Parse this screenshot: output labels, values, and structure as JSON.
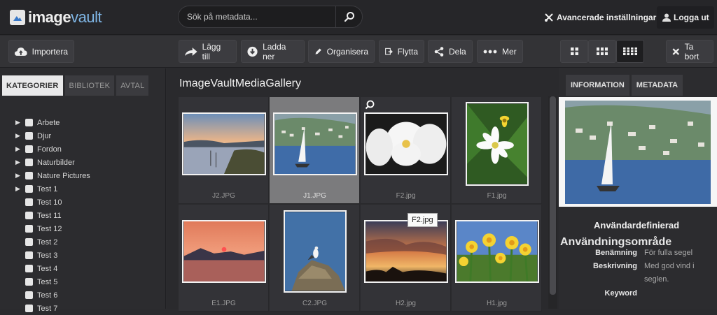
{
  "app": {
    "logo_prefix": "image",
    "logo_suffix": "vault"
  },
  "search": {
    "placeholder": "Sök på metadata..."
  },
  "header": {
    "advanced_settings": "Avancerade inställningar",
    "logout": "Logga ut"
  },
  "toolbar": {
    "import": "Importera",
    "add": "Lägg till",
    "download": "Ladda ner",
    "organize": "Organisera",
    "move": "Flytta",
    "share": "Dela",
    "more": "Mer",
    "remove": "Ta bort"
  },
  "left_tabs": [
    "KATEGORIER",
    "BIBLIOTEK",
    "AVTAL"
  ],
  "categories": [
    {
      "label": "Arbete",
      "expandable": true
    },
    {
      "label": "Djur",
      "expandable": true
    },
    {
      "label": "Fordon",
      "expandable": true
    },
    {
      "label": "Naturbilder",
      "expandable": true
    },
    {
      "label": "Nature Pictures",
      "expandable": true
    },
    {
      "label": "Test 1",
      "expandable": true
    },
    {
      "label": "Test 10",
      "expandable": false
    },
    {
      "label": "Test 11",
      "expandable": false
    },
    {
      "label": "Test 12",
      "expandable": false
    },
    {
      "label": "Test 2",
      "expandable": false
    },
    {
      "label": "Test 3",
      "expandable": false
    },
    {
      "label": "Test 4",
      "expandable": false
    },
    {
      "label": "Test 5",
      "expandable": false
    },
    {
      "label": "Test 6",
      "expandable": false
    },
    {
      "label": "Test 7",
      "expandable": false
    }
  ],
  "gallery": {
    "title": "ImageVaultMediaGallery",
    "items": [
      {
        "name": "J2.JPG"
      },
      {
        "name": "J1.JPG"
      },
      {
        "name": "F2.jpg"
      },
      {
        "name": "F1.jpg"
      },
      {
        "name": "E1.JPG"
      },
      {
        "name": "C2.JPG"
      },
      {
        "name": "H2.jpg"
      },
      {
        "name": "H1.jpg"
      }
    ],
    "tooltip": "F2.jpg"
  },
  "right_tabs": [
    "INFORMATION",
    "METADATA"
  ],
  "info": {
    "section_title": "Användardefinierad",
    "usage_label": "Användningsområde",
    "name_label": "Benämning",
    "name_value": "För fulla segel",
    "desc_label": "Beskrivning",
    "desc_value": "Med god vind i seglen.",
    "keyword_label": "Keyword"
  }
}
